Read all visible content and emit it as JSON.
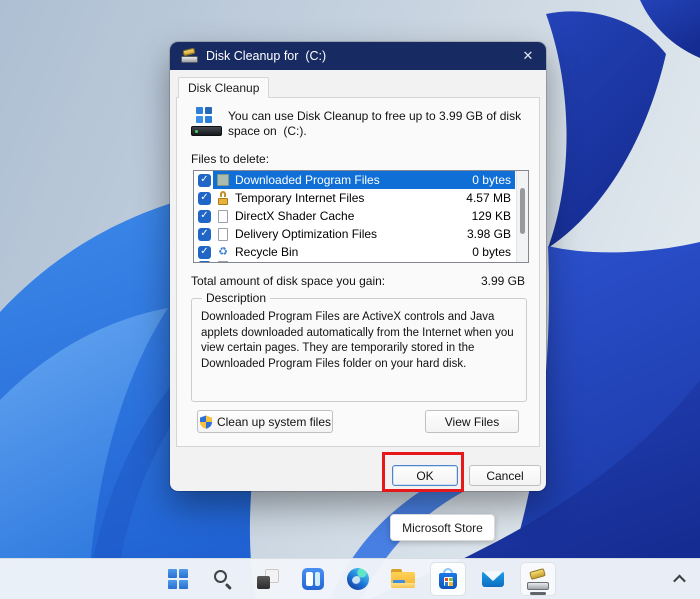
{
  "icons": {
    "close": "✕",
    "check": "✓",
    "recycle": "♻"
  },
  "colors": {
    "titlebar": "#182a62",
    "selection": "#0f6fd7",
    "checkbox": "#2066c6",
    "annotation_red": "#e5191c"
  },
  "dialog": {
    "title": "Disk Cleanup for  (C:)",
    "tab_label": "Disk Cleanup",
    "intro": "You can use Disk Cleanup to free up to 3.99 GB of disk space on  (C:).",
    "files_label": "Files to delete:",
    "files": [
      {
        "name": "Downloaded Program Files",
        "size": "0 bytes",
        "checked": true,
        "selected": true
      },
      {
        "name": "Temporary Internet Files",
        "size": "4.57 MB",
        "checked": true
      },
      {
        "name": "DirectX Shader Cache",
        "size": "129 KB",
        "checked": true
      },
      {
        "name": "Delivery Optimization Files",
        "size": "3.98 GB",
        "checked": true
      },
      {
        "name": "Recycle Bin",
        "size": "0 bytes",
        "checked": true
      }
    ],
    "total_label": "Total amount of disk space you gain:",
    "total_value": "3.99 GB",
    "description_legend": "Description",
    "description_text": "Downloaded Program Files are ActiveX controls and Java applets downloaded automatically from the Internet when you view certain pages. They are temporarily stored in the Downloaded Program Files folder on your hard disk.",
    "cleanup_button": "Clean up system files",
    "view_files_button": "View Files",
    "ok_button": "OK",
    "cancel_button": "Cancel"
  },
  "tooltip": {
    "text": "Microsoft Store"
  },
  "taskbar": {
    "icons": [
      "start",
      "search",
      "task-view",
      "widgets",
      "edge",
      "file-explorer",
      "store",
      "mail",
      "disk-cleanup"
    ],
    "overflow_chevron": "show-hidden-icons"
  }
}
